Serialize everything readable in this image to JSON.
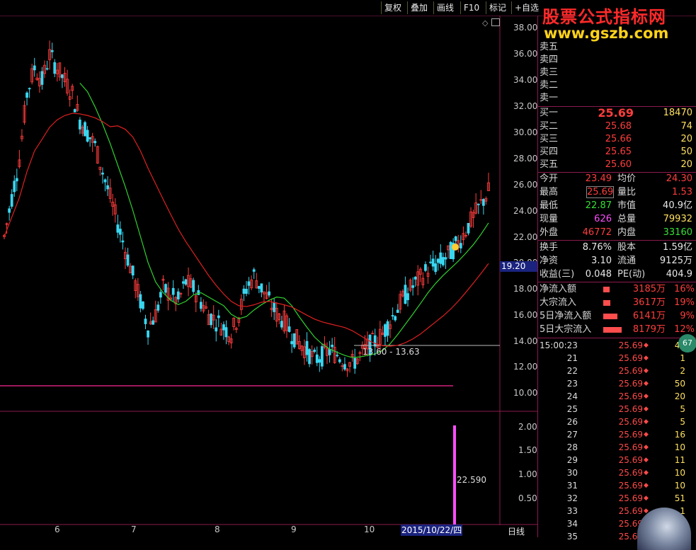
{
  "toolbar": {
    "buttons": [
      "复权",
      "叠加",
      "画线",
      "F10",
      "标记",
      "+自选"
    ]
  },
  "watermark": {
    "title": "股票公式指标网",
    "url": "www.gszb.com"
  },
  "price_axis": [
    "38.00",
    "36.00",
    "34.00",
    "32.00",
    "30.00",
    "28.00",
    "26.00",
    "24.00",
    "22.00",
    "20.00",
    "18.00",
    "16.00",
    "14.00",
    "12.00",
    "10.00"
  ],
  "current_price_tag": "19.20",
  "volume_axis": [
    "2.00",
    "1.50",
    "1.00",
    "0.50"
  ],
  "volume_label": "22.590",
  "range_label": "13.60 - 13.63",
  "months": [
    "6",
    "7",
    "8",
    "9",
    "10"
  ],
  "date_marker": "2015/10/22/四",
  "period_label": "日线",
  "order_book": {
    "sell": [
      "卖五",
      "卖四",
      "卖三",
      "卖二",
      "卖一"
    ],
    "buy": [
      {
        "label": "买一",
        "price": "25.69",
        "vol": "18470"
      },
      {
        "label": "买二",
        "price": "25.68",
        "vol": "74"
      },
      {
        "label": "买三",
        "price": "25.66",
        "vol": "20"
      },
      {
        "label": "买四",
        "price": "25.65",
        "vol": "50"
      },
      {
        "label": "买五",
        "price": "25.60",
        "vol": "20"
      }
    ]
  },
  "quote": {
    "open_label": "今开",
    "open": "23.49",
    "avg_label": "均价",
    "avg": "24.30",
    "high_label": "最高",
    "high": "25.69",
    "volratio_label": "量比",
    "volratio": "1.53",
    "low_label": "最低",
    "low": "22.87",
    "mktcap_label": "市值",
    "mktcap": "40.9亿",
    "curvol_label": "现量",
    "curvol": "626",
    "totvol_label": "总量",
    "totvol": "79932",
    "outer_label": "外盘",
    "outer": "46772",
    "inner_label": "内盘",
    "inner": "33160",
    "turnover_label": "换手",
    "turnover": "8.76%",
    "shares_label": "股本",
    "shares": "1.59亿",
    "nav_label": "净资",
    "nav": "3.10",
    "float_label": "流通",
    "float": "9125万",
    "eps_label": "收益(三)",
    "eps": "0.048",
    "pe_label": "PE(动)",
    "pe": "404.9"
  },
  "flows": [
    {
      "label": "净流入额",
      "amount": "3185万",
      "pct": "16%"
    },
    {
      "label": "大宗流入",
      "amount": "3617万",
      "pct": "19%"
    },
    {
      "label": "5日净流入额",
      "amount": "6141万",
      "pct": "9%"
    },
    {
      "label": "5日大宗流入",
      "amount": "8179万",
      "pct": "12%"
    }
  ],
  "ticks": [
    {
      "t": "15:00:23",
      "p": "25.69",
      "v": "40"
    },
    {
      "t": "21",
      "p": "25.69",
      "v": "1"
    },
    {
      "t": "22",
      "p": "25.69",
      "v": "2"
    },
    {
      "t": "23",
      "p": "25.69",
      "v": "50"
    },
    {
      "t": "24",
      "p": "25.69",
      "v": "20"
    },
    {
      "t": "25",
      "p": "25.69",
      "v": "5"
    },
    {
      "t": "26",
      "p": "25.69",
      "v": "5"
    },
    {
      "t": "27",
      "p": "25.69",
      "v": "16"
    },
    {
      "t": "28",
      "p": "25.69",
      "v": "10"
    },
    {
      "t": "29",
      "p": "25.69",
      "v": "11"
    },
    {
      "t": "30",
      "p": "25.69",
      "v": "10"
    },
    {
      "t": "31",
      "p": "25.69",
      "v": "10"
    },
    {
      "t": "32",
      "p": "25.69",
      "v": "51"
    },
    {
      "t": "33",
      "p": "25.69",
      "v": "1"
    },
    {
      "t": "34",
      "p": "25.69",
      "v": ""
    },
    {
      "t": "35",
      "p": "25.69",
      "v": ""
    }
  ],
  "badge": "67",
  "colors": {
    "up": "#ff3d3d",
    "down": "#3ad6f0",
    "ma_short": "#2fd12f",
    "ma_long": "#e02020",
    "border": "#8b1a4d"
  }
}
